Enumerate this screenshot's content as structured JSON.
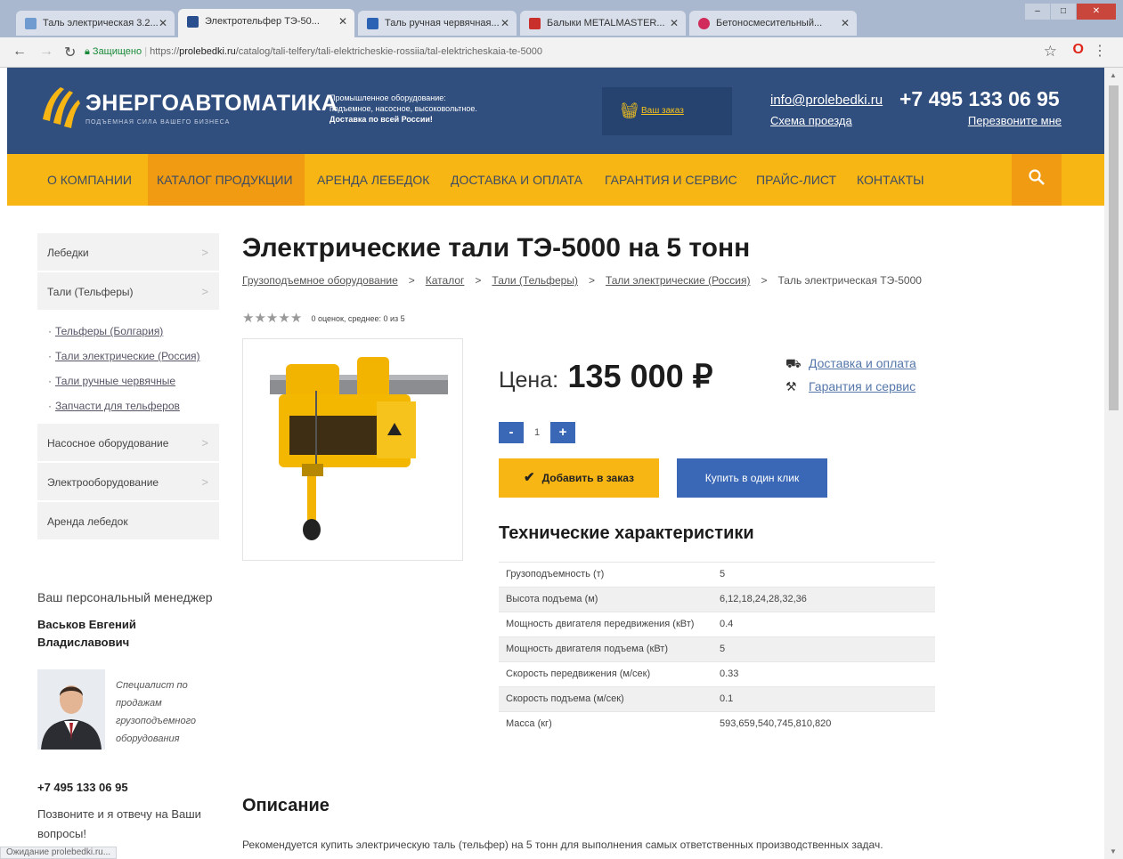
{
  "browser": {
    "tabs": [
      {
        "label": "Таль электрическая 3.2...",
        "color": "#6f9bd1"
      },
      {
        "label": "Электротельфер ТЭ-50...",
        "color": "#2a4f8f"
      },
      {
        "label": "Таль ручная червячная...",
        "color": "#2b62b3"
      },
      {
        "label": "Балыки METALMASTER...",
        "color": "#c9302c"
      },
      {
        "label": "Бетоносмесительный...",
        "color": "#d12b5b"
      }
    ],
    "window_buttons": {
      "minimize": "–",
      "maximize": "□",
      "close": "✕"
    },
    "secure_label": "Защищено",
    "url_scheme": "https://",
    "url_host": "prolebedki.ru",
    "url_path": "/catalog/tali-telfery/tali-elektricheskie-rossiia/tal-elektricheskaia-te-5000",
    "status_text": "Ожидание prolebedki.ru..."
  },
  "header": {
    "logo_name": "ЭНЕРГОАВТОМАТИКА",
    "logo_tagline": "ПОДЪЕМНАЯ СИЛА ВАШЕГО БИЗНЕСА",
    "info_lines": [
      "Промышленное оборудование:",
      "подъемное, насосное, высоковольтное.",
      "Доставка по всей России!"
    ],
    "order_label": "Ваш заказ",
    "email": "info@prolebedki.ru",
    "map_link": "Схема проезда",
    "phone": "+7 495 133 06 95",
    "callback": "Перезвоните мне"
  },
  "nav": {
    "items": [
      "О КОМПАНИИ",
      "КАТАЛОГ ПРОДУКЦИИ",
      "АРЕНДА ЛЕБЕДОК",
      "ДОСТАВКА И ОПЛАТА",
      "ГАРАНТИЯ И СЕРВИС",
      "ПРАЙС-ЛИСТ",
      "КОНТАКТЫ"
    ],
    "active": "КАТАЛОГ ПРОДУКЦИИ"
  },
  "sidebar": {
    "items": [
      "Лебедки",
      "Тали (Тельферы)",
      "Насосное оборудование",
      "Электрооборудование",
      "Аренда лебедок"
    ],
    "sub_items": [
      "Тельферы (Болгария)",
      "Тали электрические (Россия)",
      "Тали ручные червячные",
      "Запчасти для тельферов"
    ],
    "manager_title": "Ваш персональный менеджер",
    "manager_name": "Васьков Евгений Владиславович",
    "manager_role": "Специалист по продажам грузоподъемного оборудования",
    "manager_phone": "+7 495 133 06 95",
    "manager_note": "Позвоните и я отвечу на Ваши вопросы!"
  },
  "product": {
    "title": "Электрические тали ТЭ-5000 на 5 тонн",
    "breadcrumb": [
      "Грузоподъемное оборудование",
      "Каталог",
      "Тали (Тельферы)",
      "Тали электрические (Россия)",
      "Таль электрическая ТЭ-5000"
    ],
    "breadcrumb_sep": ">",
    "rating_text": "0 оценок, среднее: 0 из 5",
    "rating_stars": 0,
    "price_label": "Цена:",
    "price_value": "135 000 ₽",
    "delivery_link": "Доставка и оплата",
    "warranty_link": "Гарантия и сервис",
    "qty_minus": "-",
    "qty_plus": "+",
    "quantity": "1",
    "add_to_order": "Добавить в заказ",
    "buy_one_click": "Купить в один клик",
    "specs_title": "Технические характеристики",
    "specs": [
      [
        "Грузоподъемность (т)",
        "5"
      ],
      [
        "Высота подъема (м)",
        "6,12,18,24,28,32,36"
      ],
      [
        "Мощность двигателя передвижения (кВт)",
        "0.4"
      ],
      [
        "Мощность двигателя подъема (кВт)",
        "5"
      ],
      [
        "Скорость передвижения (м/сек)",
        "0.33"
      ],
      [
        "Скорость подъема (м/сек)",
        "0.1"
      ],
      [
        "Масса (кг)",
        "593,659,540,745,810,820"
      ]
    ],
    "description_title": "Описание",
    "description_text": "Рекомендуется купить электрическую таль (тельфер) на 5 тонн для выполнения самых ответственных производственных задач."
  },
  "colors": {
    "header_bg": "#304e7e",
    "nav_bg": "#f7b614",
    "nav_active": "#f09b12",
    "accent_blue": "#3a68b6"
  }
}
